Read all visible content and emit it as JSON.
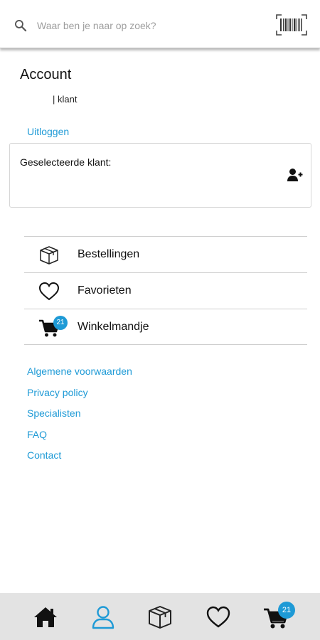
{
  "search": {
    "placeholder": "Waar ben je naar op zoek?"
  },
  "account": {
    "title": "Account",
    "subtitle": "| klant",
    "logout_label": "Uitloggen"
  },
  "customer_card": {
    "label": "Geselecteerde klant:"
  },
  "menu": {
    "items": [
      {
        "label": "Bestellingen",
        "icon": "box-icon"
      },
      {
        "label": "Favorieten",
        "icon": "heart-icon"
      },
      {
        "label": "Winkelmandje",
        "icon": "cart-icon",
        "badge": "21"
      }
    ]
  },
  "links": [
    "Algemene voorwaarden",
    "Privacy policy",
    "Specialisten",
    "FAQ",
    "Contact"
  ],
  "bottom_nav": {
    "items": [
      {
        "icon": "home-icon",
        "active": false
      },
      {
        "icon": "user-icon",
        "active": true
      },
      {
        "icon": "box-icon",
        "active": false
      },
      {
        "icon": "heart-icon",
        "active": false
      },
      {
        "icon": "cart-icon",
        "active": false,
        "badge": "21"
      }
    ]
  },
  "colors": {
    "accent": "#1e9ad6",
    "nav_background": "#e3e3e3",
    "text": "#111111"
  }
}
